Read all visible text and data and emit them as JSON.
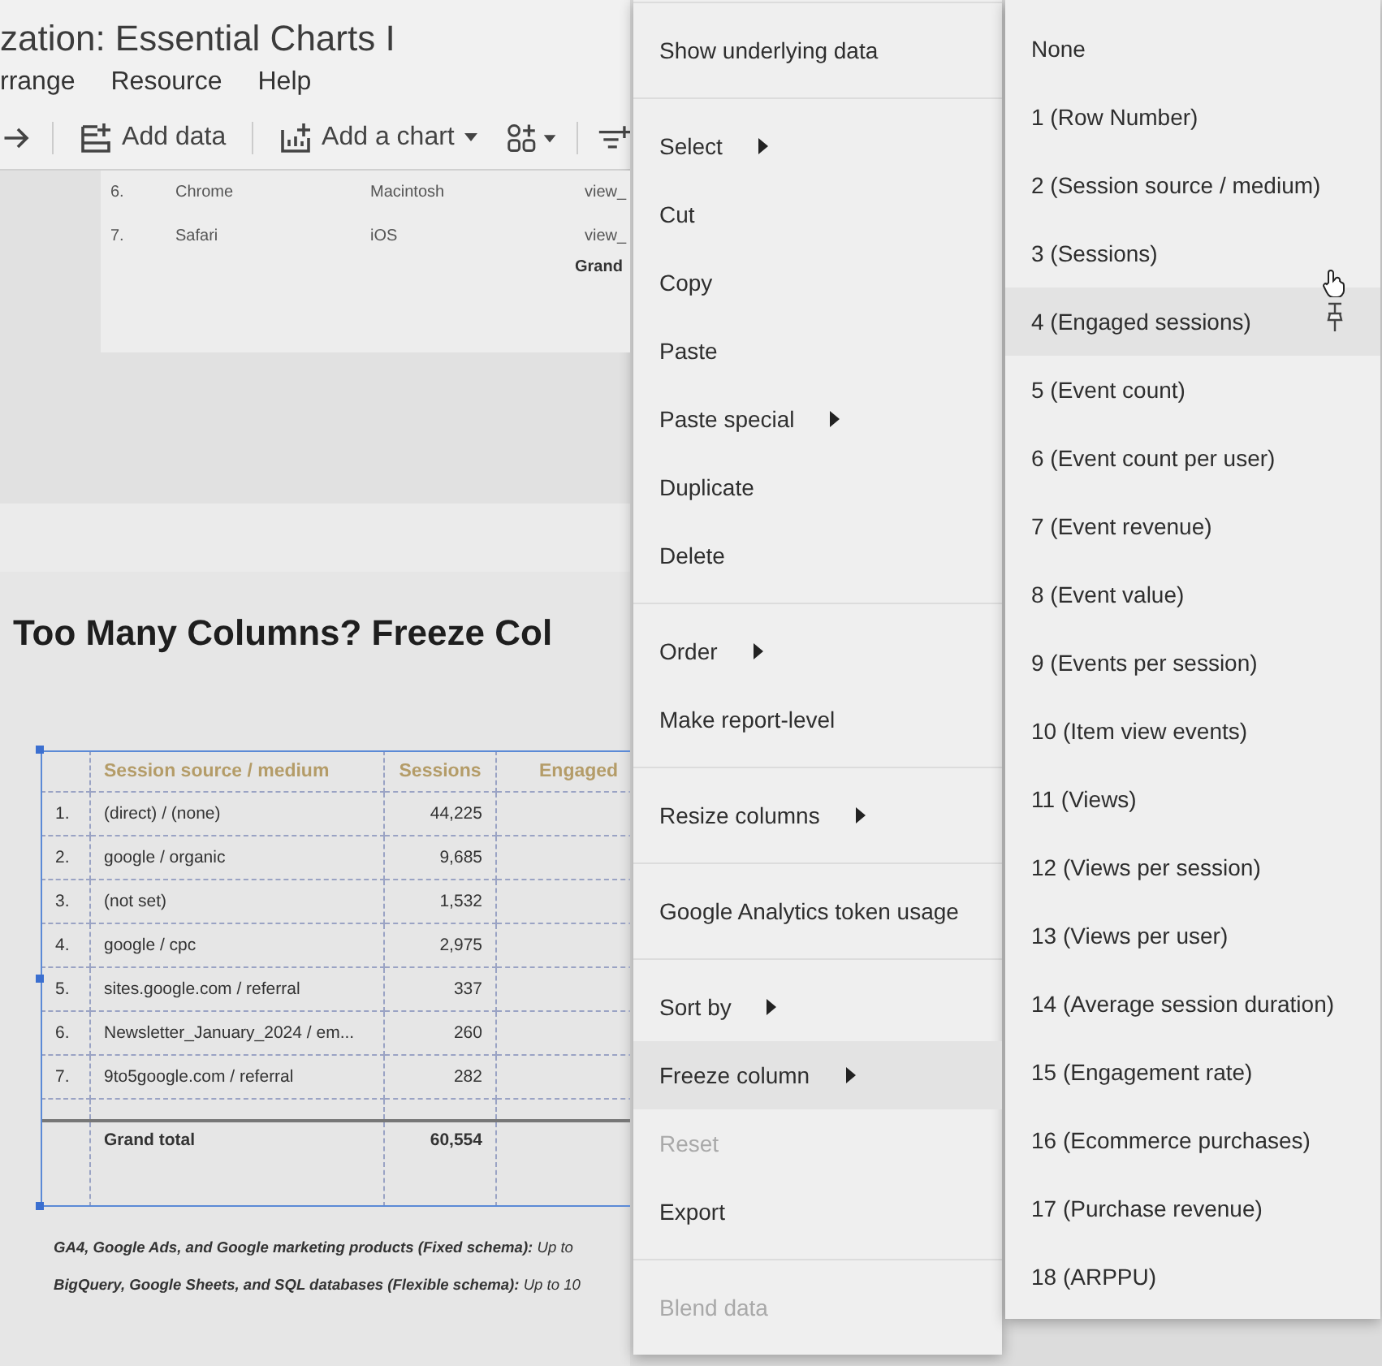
{
  "header": {
    "title": "zation: Essential Charts I",
    "menus": [
      "rrange",
      "Resource",
      "Help"
    ],
    "toolbar": {
      "add_data": "Add data",
      "add_chart": "Add a chart"
    }
  },
  "top_table": {
    "rows": [
      [
        "6.",
        "Chrome",
        "Macintosh",
        "view_"
      ],
      [
        "7.",
        "Safari",
        "iOS",
        "view_"
      ]
    ],
    "total_label": "Grand"
  },
  "section": {
    "heading": "Too Many Columns? Freeze Col",
    "table": {
      "selected": true,
      "columns": [
        "Session source / medium",
        "Sessions",
        "Engaged"
      ],
      "rows": [
        {
          "index": "1.",
          "source": "(direct) / (none)",
          "sessions": "44,225"
        },
        {
          "index": "2.",
          "source": "google / organic",
          "sessions": "9,685"
        },
        {
          "index": "3.",
          "source": "(not set)",
          "sessions": "1,532"
        },
        {
          "index": "4.",
          "source": "google / cpc",
          "sessions": "2,975"
        },
        {
          "index": "5.",
          "source": "sites.google.com / referral",
          "sessions": "337"
        },
        {
          "index": "6.",
          "source": "Newsletter_January_2024 / em...",
          "sessions": "260"
        },
        {
          "index": "7.",
          "source": "9to5google.com / referral",
          "sessions": "282"
        }
      ],
      "total": {
        "label": "Grand total",
        "sessions": "60,554"
      }
    },
    "notes": [
      "**GA4, Google Ads, and Google marketing products (Fixed schema):** Up to",
      "**BigQuery, Google Sheets, and SQL databases (Flexible schema):** Up to 10"
    ]
  },
  "context_menu": {
    "sections": [
      [
        {
          "label": "Show underlying data",
          "submenu": false,
          "disabled": false,
          "hovered": false
        }
      ],
      [
        {
          "label": "Select",
          "submenu": true,
          "disabled": false,
          "hovered": false
        },
        {
          "label": "Cut",
          "submenu": false,
          "disabled": false,
          "hovered": false
        },
        {
          "label": "Copy",
          "submenu": false,
          "disabled": false,
          "hovered": false
        },
        {
          "label": "Paste",
          "submenu": false,
          "disabled": false,
          "hovered": false
        },
        {
          "label": "Paste special",
          "submenu": true,
          "disabled": false,
          "hovered": false
        },
        {
          "label": "Duplicate",
          "submenu": false,
          "disabled": false,
          "hovered": false
        },
        {
          "label": "Delete",
          "submenu": false,
          "disabled": false,
          "hovered": false
        }
      ],
      [
        {
          "label": "Order",
          "submenu": true,
          "disabled": false,
          "hovered": false
        },
        {
          "label": "Make report-level",
          "submenu": false,
          "disabled": false,
          "hovered": false
        }
      ],
      [
        {
          "label": "Resize columns",
          "submenu": true,
          "disabled": false,
          "hovered": false
        }
      ],
      [
        {
          "label": "Google Analytics token usage",
          "submenu": false,
          "disabled": false,
          "hovered": false
        }
      ],
      [
        {
          "label": "Sort by",
          "submenu": true,
          "disabled": false,
          "hovered": false
        },
        {
          "label": "Freeze column",
          "submenu": true,
          "disabled": false,
          "hovered": true
        },
        {
          "label": "Reset",
          "submenu": false,
          "disabled": true,
          "hovered": false
        },
        {
          "label": "Export",
          "submenu": false,
          "disabled": false,
          "hovered": false
        }
      ],
      [
        {
          "label": "Blend data",
          "submenu": false,
          "disabled": true,
          "hovered": false
        }
      ]
    ]
  },
  "freeze_submenu": {
    "items": [
      {
        "label": "None",
        "hovered": false
      },
      {
        "label": "1 (Row Number)",
        "hovered": false
      },
      {
        "label": "2 (Session source / medium)",
        "hovered": false
      },
      {
        "label": "3 (Sessions)",
        "hovered": false
      },
      {
        "label": "4 (Engaged sessions)",
        "hovered": true
      },
      {
        "label": "5 (Event count)",
        "hovered": false
      },
      {
        "label": "6 (Event count per user)",
        "hovered": false
      },
      {
        "label": "7 (Event revenue)",
        "hovered": false
      },
      {
        "label": "8 (Event value)",
        "hovered": false
      },
      {
        "label": "9 (Events per session)",
        "hovered": false
      },
      {
        "label": "10 (Item view events)",
        "hovered": false
      },
      {
        "label": "11 (Views)",
        "hovered": false
      },
      {
        "label": "12 (Views per session)",
        "hovered": false
      },
      {
        "label": "13 (Views per user)",
        "hovered": false
      },
      {
        "label": "14 (Average session duration)",
        "hovered": false
      },
      {
        "label": "15 (Engagement rate)",
        "hovered": false
      },
      {
        "label": "16 (Ecommerce purchases)",
        "hovered": false
      },
      {
        "label": "17 (Purchase revenue)",
        "hovered": false
      },
      {
        "label": "18 (ARPPU)",
        "hovered": false
      }
    ]
  }
}
